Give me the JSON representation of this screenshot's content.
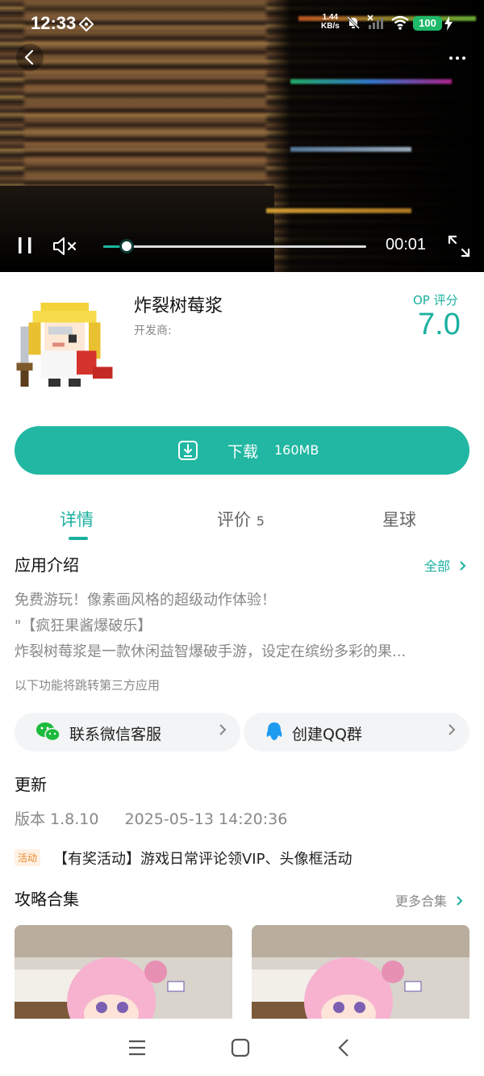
{
  "status_bar": {
    "time": "12:33",
    "net_speed_value": "1.44",
    "net_speed_unit": "KB/s",
    "battery": "100"
  },
  "video": {
    "timecode": "00:01",
    "progress_fraction": 0.09
  },
  "app": {
    "name": "炸裂树莓浆",
    "developer_label": "开发商:",
    "op_label": "OP 评分",
    "op_score": "7.0"
  },
  "download": {
    "label": "下载",
    "size": "160MB"
  },
  "tabs": [
    {
      "label": "详情",
      "count": ""
    },
    {
      "label": "评价",
      "count": "5"
    },
    {
      "label": "星球",
      "count": ""
    }
  ],
  "intro": {
    "title": "应用介绍",
    "more_label": "全部",
    "lines": [
      "免费游玩！像素画风格的超级动作体验！",
      "\"【疯狂果酱爆破乐】",
      "炸裂树莓浆是一款休闲益智爆破手游，设定在缤纷多彩的果..."
    ],
    "third_party_note": "以下功能将跳转第三方应用"
  },
  "actions": {
    "wechat_label": "联系微信客服",
    "qq_label": "创建QQ群"
  },
  "update": {
    "title": "更新",
    "version": "版本 1.8.10",
    "date": "2025-05-13 14:20:36"
  },
  "activity": {
    "tag": "活动",
    "text": "【有奖活动】游戏日常评论领VIP、头像框活动"
  },
  "guides": {
    "title": "攻略合集",
    "more_label": "更多合集"
  },
  "colors": {
    "accent": "#21b7a2",
    "tag_bg": "#fff1e3",
    "tag_text": "#e9882f"
  }
}
